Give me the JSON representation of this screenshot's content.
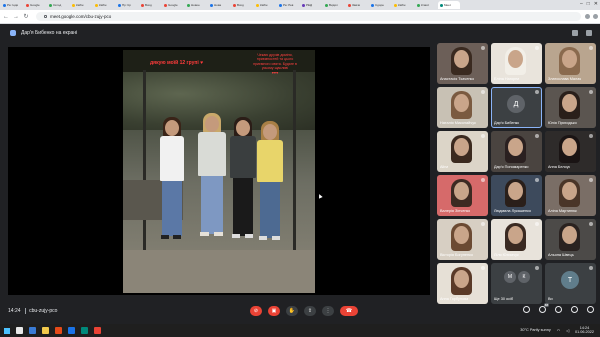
{
  "browser": {
    "tabs": [
      {
        "label": "Ра: Інди",
        "color": "#1a73e8"
      },
      {
        "label": "Google",
        "color": "#ea4335"
      },
      {
        "label": "Сёгод",
        "color": "#34a853"
      },
      {
        "label": "Кабін",
        "color": "#fbbc04"
      },
      {
        "label": "Кабін",
        "color": "#fbbc04"
      },
      {
        "label": "Пр: Кр",
        "color": "#1a73e8"
      },
      {
        "label": "Вход",
        "color": "#ea4335"
      },
      {
        "label": "Google",
        "color": "#ea4335"
      },
      {
        "label": "Новое",
        "color": "#34a853"
      },
      {
        "label": "Нова",
        "color": "#1a73e8"
      },
      {
        "label": "Вход",
        "color": "#ea4335"
      },
      {
        "label": "Кабін",
        "color": "#fbbc04"
      },
      {
        "label": "Ра: Рев",
        "color": "#1a73e8"
      },
      {
        "label": "РЕД",
        "color": "#673ab7"
      },
      {
        "label": "Видил",
        "color": "#34a853"
      },
      {
        "label": "Завчи",
        "color": "#ea4335"
      },
      {
        "label": "Сдоре",
        "color": "#1a73e8"
      },
      {
        "label": "Кабін",
        "color": "#fbbc04"
      },
      {
        "label": "Класс",
        "color": "#34a853"
      },
      {
        "label": "Meet",
        "color": "#00897b"
      }
    ],
    "active_tab_index": 19,
    "url": "meet.google.com/cbu-zujy-pco",
    "window_controls": [
      "–",
      "□",
      "✕"
    ]
  },
  "meet": {
    "presenting_label": "Дар'я Бибенко на екрані",
    "photo_caption_main": "дякую моїй 12 групі",
    "photo_caption_side": "Чекаю друзів доміня, приємностей та цього приємного свята. Будьте в усьому щасливі",
    "photo_hearts": "♥♥♥",
    "meeting_time": "14:24",
    "meeting_code": "cbu-zujy-pco",
    "participants": [
      {
        "name": "Анастасія Ткаченко",
        "type": "video",
        "bg": "#6c5f58",
        "hair": "#3a2a20"
      },
      {
        "name": "Еліна Нагорна",
        "type": "video",
        "bg": "#e9e4dc",
        "hair": "#f2efe8"
      },
      {
        "name": "Златослава Малая",
        "type": "video",
        "bg": "#b9a58f",
        "hair": "#8a6a4e"
      },
      {
        "name": "Наталія Миколайчук",
        "type": "video",
        "bg": "#c8c1b4",
        "hair": "#7a5a40"
      },
      {
        "name": "Дар'я Бибенко",
        "type": "avatar",
        "initial": "Д",
        "avatar_color": "#5f6368",
        "highlight": true
      },
      {
        "name": "Юлія Приходько",
        "type": "video",
        "bg": "#5b5550",
        "hair": "#2a1f1a"
      },
      {
        "name": "Alina",
        "type": "video",
        "bg": "#dcd5c8",
        "hair": "#3b2a1f"
      },
      {
        "name": "Дар'я Пономаренко",
        "type": "video",
        "bg": "#4a4440",
        "hair": "#2a2020"
      },
      {
        "name": "Анна Белоус",
        "type": "video",
        "bg": "#2e2b2a",
        "hair": "#1a1414"
      },
      {
        "name": "Валерія Зінченко",
        "type": "video",
        "bg": "#d66a6a",
        "hair": "#3d2a22"
      },
      {
        "name": "Людмила Лукашенко",
        "type": "video",
        "bg": "#3d4a5c",
        "hair": "#2a1f1a"
      },
      {
        "name": "Аліна Мартинюк",
        "type": "video",
        "bg": "#7a6e66",
        "hair": "#4a3528"
      },
      {
        "name": "Вікторія Богуненко",
        "type": "video",
        "bg": "#d7cfc3",
        "hair": "#6b4a33"
      },
      {
        "name": "Ліля Юхимчук",
        "type": "video",
        "bg": "#e8e3db",
        "hair": "#3a2a22"
      },
      {
        "name": "Альона Швець",
        "type": "video",
        "bg": "#4c4a48",
        "hair": "#2a2220"
      },
      {
        "name": "Анна Горбунова",
        "type": "video",
        "bg": "#e6e0d6",
        "hair": "#5a3a28"
      },
      {
        "name": "Ще 30 осіб",
        "type": "others",
        "initials": [
          "М",
          "К"
        ]
      },
      {
        "name": "Ви",
        "type": "avatar",
        "initial": "Т",
        "avatar_color": "#607d8b"
      }
    ],
    "participant_count_badge": "48"
  },
  "taskbar": {
    "weather": "30°C  Partly sunny",
    "time": "14:24",
    "date": "01.06.2022",
    "icon_colors": [
      "#e8e8e8",
      "#3a7bd5",
      "#f2c94c",
      "#e64a19",
      "#1a73e8",
      "#00897b",
      "#ea4335"
    ]
  }
}
